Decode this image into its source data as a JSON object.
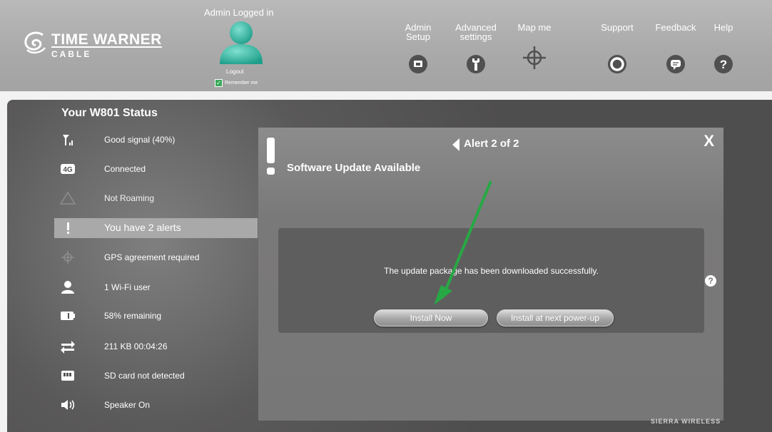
{
  "header": {
    "logo_line1": "TIME WARNER",
    "logo_line2": "CABLE",
    "admin_title": "Admin Logged in",
    "logout_label": "Logout",
    "remember_label": "Remember me",
    "remember_checked": true,
    "nav": [
      {
        "label": "Admin\nSetup",
        "icon": "admin-setup-icon"
      },
      {
        "label": "Advanced\nsettings",
        "icon": "wrench-icon"
      },
      {
        "label": "Map me",
        "icon": "crosshair-icon"
      },
      {
        "label": "Support",
        "icon": "lifebuoy-icon"
      },
      {
        "label": "Feedback",
        "icon": "speech-bubble-icon"
      },
      {
        "label": "Help",
        "icon": "question-icon"
      }
    ]
  },
  "status": {
    "title": "Your W801 Status",
    "items": [
      {
        "icon": "signal-icon",
        "text": "Good signal (40%)"
      },
      {
        "icon": "4g-icon",
        "text": "Connected",
        "badge": "4G"
      },
      {
        "icon": "roaming-icon",
        "text": "Not Roaming"
      },
      {
        "icon": "alert-icon",
        "text": "You have 2 alerts"
      },
      {
        "icon": "gps-icon",
        "text": "GPS agreement required"
      },
      {
        "icon": "user-icon",
        "text": "1 Wi-Fi user"
      },
      {
        "icon": "battery-icon",
        "text": "58% remaining"
      },
      {
        "icon": "transfer-icon",
        "text": "211 KB  00:04:26"
      },
      {
        "icon": "sd-card-icon",
        "text": "SD card not detected"
      },
      {
        "icon": "speaker-icon",
        "text": "Speaker On"
      }
    ]
  },
  "modal": {
    "alert_label": "Alert 2 of 2",
    "title": "Software Update Available",
    "close_label": "X",
    "message": "The update package has been downloaded successfully.",
    "install_now": "Install Now",
    "install_later": "Install at next power-up",
    "help": "?"
  },
  "colors": {
    "header_bg": "#a9a9a9",
    "main_bg": "#5f5e5e",
    "highlight": "#a9a9a9",
    "arrow": "#27a844",
    "avatar": "#38b8a4"
  }
}
